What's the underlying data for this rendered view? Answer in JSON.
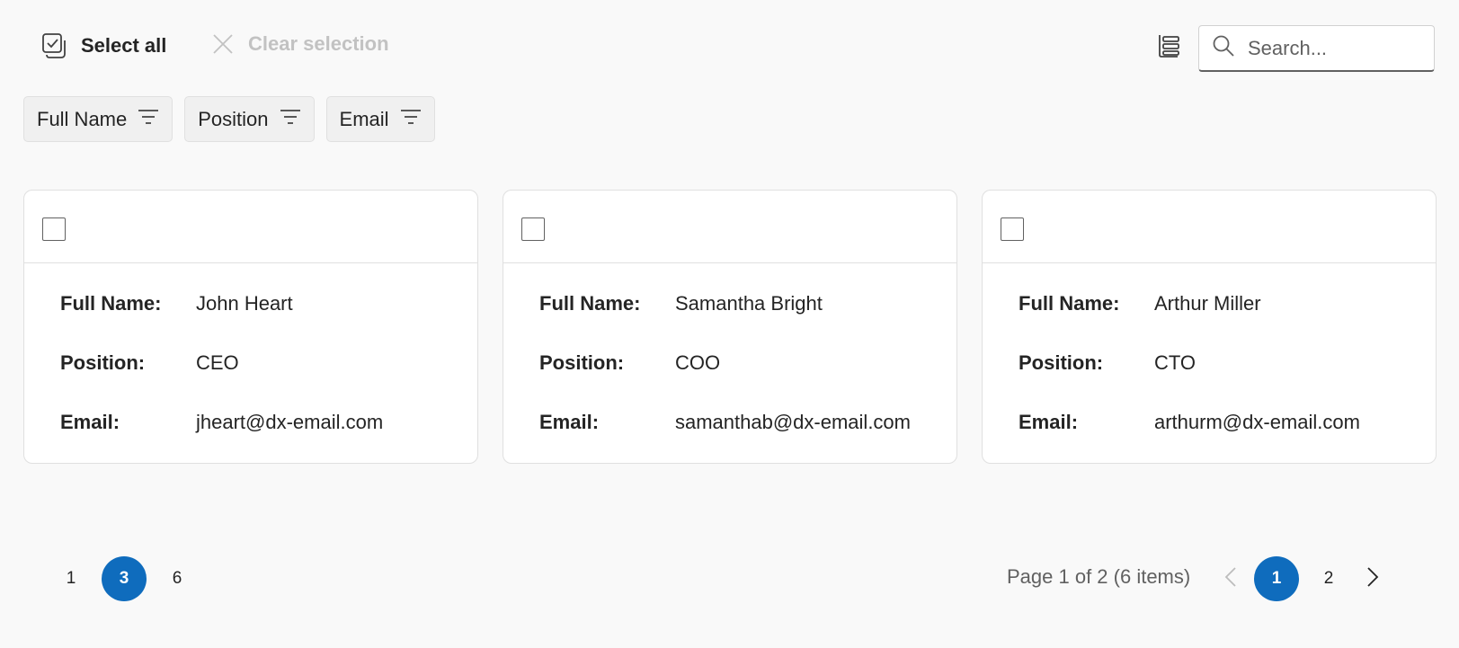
{
  "toolbar": {
    "select_all_label": "Select all",
    "clear_selection_label": "Clear selection",
    "search_placeholder": "Search..."
  },
  "columns": [
    {
      "label": "Full Name"
    },
    {
      "label": "Position"
    },
    {
      "label": "Email"
    }
  ],
  "cards": [
    {
      "checked": false,
      "fields": [
        {
          "label": "Full Name:",
          "value": "John Heart"
        },
        {
          "label": "Position:",
          "value": "CEO"
        },
        {
          "label": "Email:",
          "value": "jheart@dx-email.com"
        }
      ]
    },
    {
      "checked": false,
      "fields": [
        {
          "label": "Full Name:",
          "value": "Samantha Bright"
        },
        {
          "label": "Position:",
          "value": "COO"
        },
        {
          "label": "Email:",
          "value": "samanthab@dx-email.com"
        }
      ]
    },
    {
      "checked": false,
      "fields": [
        {
          "label": "Full Name:",
          "value": "Arthur Miller"
        },
        {
          "label": "Position:",
          "value": "CTO"
        },
        {
          "label": "Email:",
          "value": "arthurm@dx-email.com"
        }
      ]
    }
  ],
  "pager": {
    "page_sizes": [
      "1",
      "3",
      "6"
    ],
    "selected_page_size": "3",
    "info": "Page 1 of 2 (6 items)",
    "pages": [
      "1",
      "2"
    ],
    "current_page": "1"
  },
  "colors": {
    "accent": "#0f6cbd",
    "disabled_text": "#c2c2c2",
    "background": "#f9f9f9"
  }
}
